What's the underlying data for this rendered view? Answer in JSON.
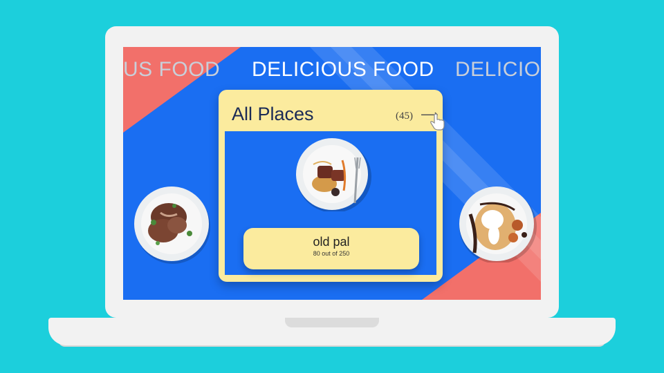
{
  "marquee": {
    "left_text": "US FOOD",
    "center_text": "DELICIOUS FOOD",
    "right_text": "DELICIOU"
  },
  "card": {
    "title": "All Places",
    "count": "(45)",
    "arrow_icon": "arrow-right-icon"
  },
  "featured": {
    "name": "old pal",
    "subtitle": "80 out of 250"
  },
  "colors": {
    "background": "#1ccfdc",
    "screen": "#1a6ef2",
    "accent_coral": "#f2706a",
    "card": "#fbeb9e"
  }
}
